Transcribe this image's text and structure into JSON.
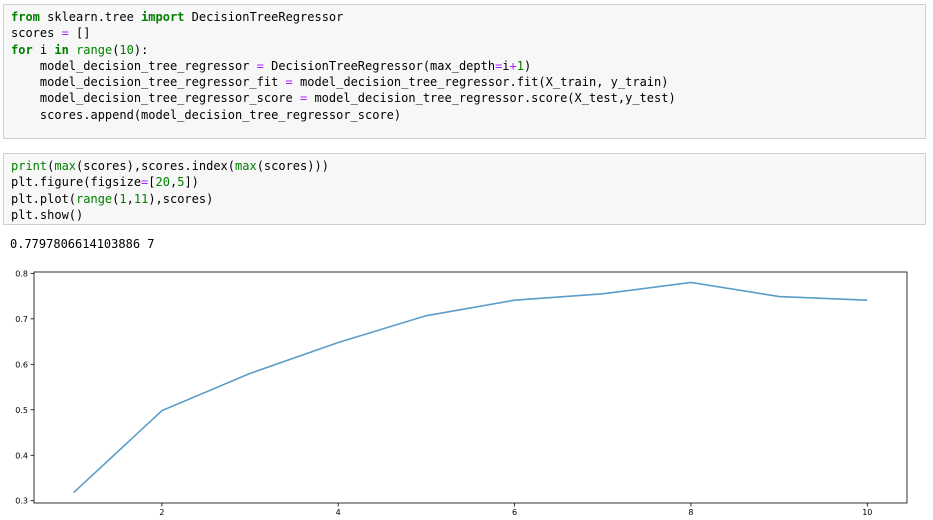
{
  "cell1": {
    "lines": [
      [
        {
          "t": "from",
          "c": "kw"
        },
        {
          "t": " sklearn.tree "
        },
        {
          "t": "import",
          "c": "kw"
        },
        {
          "t": " DecisionTreeRegressor"
        }
      ],
      [
        {
          "t": "scores "
        },
        {
          "t": "=",
          "c": "op"
        },
        {
          "t": " []"
        }
      ],
      [
        {
          "t": "for",
          "c": "kw"
        },
        {
          "t": " i "
        },
        {
          "t": "in",
          "c": "kw"
        },
        {
          "t": " "
        },
        {
          "t": "range",
          "c": "bi"
        },
        {
          "t": "("
        },
        {
          "t": "10",
          "c": "num"
        },
        {
          "t": "):"
        }
      ],
      [
        {
          "t": "    model_decision_tree_regressor "
        },
        {
          "t": "=",
          "c": "op"
        },
        {
          "t": " DecisionTreeRegressor(max_depth"
        },
        {
          "t": "=",
          "c": "op"
        },
        {
          "t": "i"
        },
        {
          "t": "+",
          "c": "op"
        },
        {
          "t": "1",
          "c": "num"
        },
        {
          "t": ")"
        }
      ],
      [
        {
          "t": "    model_decision_tree_regressor_fit "
        },
        {
          "t": "=",
          "c": "op"
        },
        {
          "t": " model_decision_tree_regressor.fit(X_train, y_train)"
        }
      ],
      [
        {
          "t": "    model_decision_tree_regressor_score "
        },
        {
          "t": "=",
          "c": "op"
        },
        {
          "t": " model_decision_tree_regressor.score(X_test,y_test)"
        }
      ],
      [
        {
          "t": "    scores.append(model_decision_tree_regressor_score)"
        }
      ]
    ]
  },
  "cell2": {
    "lines": [
      [
        {
          "t": "print",
          "c": "bi"
        },
        {
          "t": "("
        },
        {
          "t": "max",
          "c": "bi"
        },
        {
          "t": "(scores),scores.index("
        },
        {
          "t": "max",
          "c": "bi"
        },
        {
          "t": "(scores)))"
        }
      ],
      [
        {
          "t": "plt.figure(figsize"
        },
        {
          "t": "=",
          "c": "op"
        },
        {
          "t": "["
        },
        {
          "t": "20",
          "c": "num"
        },
        {
          "t": ","
        },
        {
          "t": "5",
          "c": "num"
        },
        {
          "t": "])"
        }
      ],
      [
        {
          "t": "plt.plot("
        },
        {
          "t": "range",
          "c": "bi"
        },
        {
          "t": "("
        },
        {
          "t": "1",
          "c": "num"
        },
        {
          "t": ","
        },
        {
          "t": "11",
          "c": "num"
        },
        {
          "t": "),scores)"
        }
      ],
      [
        {
          "t": "plt.show()"
        }
      ]
    ]
  },
  "output": {
    "text": "0.7797806614103886 7"
  },
  "colors": {
    "keyword": "#008000",
    "operator": "#aa22ff",
    "line": "#5b9dc9"
  },
  "chart_data": {
    "type": "line",
    "x": [
      1,
      2,
      3,
      4,
      5,
      6,
      7,
      8,
      9,
      10
    ],
    "series": [
      {
        "values": [
          0.318,
          0.498,
          0.58,
          0.648,
          0.707,
          0.741,
          0.755,
          0.78,
          0.749,
          0.741
        ]
      }
    ],
    "xticks": [
      2,
      4,
      6,
      8,
      10
    ],
    "yticks": [
      0.3,
      0.4,
      0.5,
      0.6,
      0.7,
      0.8
    ],
    "xlim": [
      0.55,
      10.45
    ],
    "ylim": [
      0.295,
      0.803
    ],
    "grid": false,
    "title": "",
    "xlabel": "",
    "ylabel": ""
  }
}
